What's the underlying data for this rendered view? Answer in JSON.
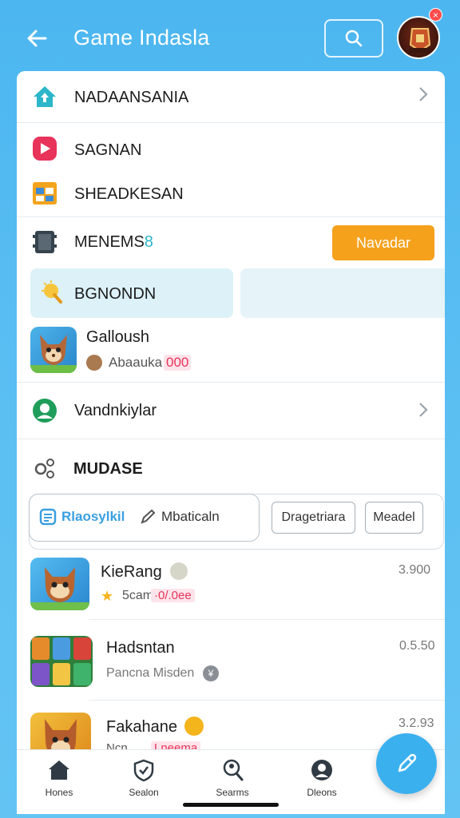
{
  "header": {
    "title": "Game Indasla",
    "back_icon": "arrow-left-icon",
    "search_icon": "search-icon",
    "avatar_badge": "×"
  },
  "menu": {
    "item1": "NADAANSANIA",
    "item2": "SAGNAN",
    "item3": "SHEADKESAN",
    "item4": "MENEMS",
    "item4_suffix": "8",
    "item4_button": "Navadar",
    "item5": "BGNONDN",
    "item6_title": "Galloush",
    "item6_sub": "Abaauka",
    "item6_badge": "000",
    "item7": "Vandnkiylar",
    "section_title": "MUDASE"
  },
  "filters": {
    "pill1": "Rlaosylkil",
    "pill2": "Mbaticaln",
    "btn1": "Dragetriara",
    "btn2": "Meadel"
  },
  "list": [
    {
      "title": "KieRang",
      "sub": "5cam",
      "tag": "·0/.0ee",
      "price": "3.900"
    },
    {
      "title": "Hadsntan",
      "sub": "Pancna Misden",
      "tag": "",
      "price": "0.5.50"
    },
    {
      "title": "Fakahane",
      "sub": "Ncn",
      "tag": "Lneema",
      "price": "3.2.93"
    }
  ],
  "nav": [
    {
      "label": "Hones",
      "icon": "home-icon"
    },
    {
      "label": "Sealon",
      "icon": "shield-icon"
    },
    {
      "label": "Searms",
      "icon": "search-person-icon"
    },
    {
      "label": "Dleons",
      "icon": "person-icon"
    }
  ],
  "colors": {
    "accent": "#3ab0ef",
    "orange": "#f5a11c",
    "bg": "#5bbff2"
  }
}
